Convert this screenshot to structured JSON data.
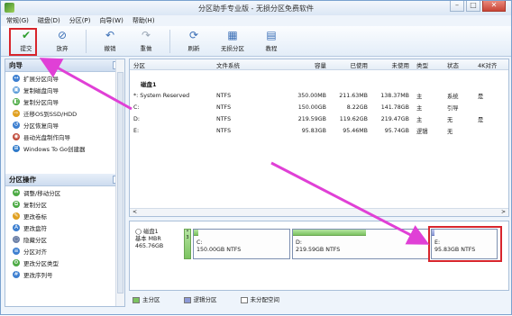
{
  "title": "分区助手专业版 - 无损分区免费软件",
  "menu": [
    "常规(G)",
    "磁盘(D)",
    "分区(P)",
    "向导(W)",
    "帮助(H)"
  ],
  "toolbar": [
    {
      "label": "提交",
      "icon": "check-icon"
    },
    {
      "label": "放弃",
      "icon": "discard-icon"
    },
    {
      "label": "撤销",
      "icon": "undo-icon"
    },
    {
      "label": "重做",
      "icon": "redo-icon"
    },
    {
      "label": "刷新",
      "icon": "refresh-icon"
    },
    {
      "label": "无损分区",
      "icon": "partition-icon"
    },
    {
      "label": "教程",
      "icon": "tutorial-icon"
    }
  ],
  "wizard_panel": {
    "title": "向导",
    "items": [
      "扩展分区向导",
      "复制磁盘向导",
      "复制分区向导",
      "迁移OS到SSD/HDD",
      "分区恢复向导",
      "县动光盘制作向导",
      "Windows To Go创建器"
    ]
  },
  "ops_panel": {
    "title": "分区操作",
    "items": [
      "调整/移动分区",
      "复制分区",
      "更改卷标",
      "更改盘符",
      "隐藏分区",
      "分区对齐",
      "更改分区类型",
      "更改序列号"
    ]
  },
  "table": {
    "headers": [
      "分区",
      "文件系统",
      "容量",
      "已使用",
      "未使用",
      "类型",
      "状态",
      "4K对齐"
    ],
    "disk_label": "磁盘1",
    "rows": [
      [
        "*: System Reserved",
        "NTFS",
        "350.00MB",
        "211.63MB",
        "138.37MB",
        "主",
        "系统",
        "是"
      ],
      [
        "C:",
        "NTFS",
        "150.00GB",
        "8.22GB",
        "141.78GB",
        "主",
        "引导",
        ""
      ],
      [
        "D:",
        "NTFS",
        "219.59GB",
        "119.62GB",
        "219.47GB",
        "主",
        "无",
        "是"
      ],
      [
        "E:",
        "NTFS",
        "95.83GB",
        "95.46MB",
        "95.74GB",
        "逻辑",
        "无",
        ""
      ]
    ]
  },
  "diskmap": {
    "disk_name": "磁盘1",
    "disk_type": "基本 MBR",
    "disk_size": "465.76GB",
    "sys_label": "*",
    "sys_num": "3",
    "parts": [
      {
        "name": "C:",
        "info": "150.00GB NTFS",
        "fill": 0.05
      },
      {
        "name": "D:",
        "info": "219.59GB NTFS",
        "fill": 0.54
      },
      {
        "name": "E:",
        "info": "95.83GB NTFS",
        "fill": 0.01
      }
    ]
  },
  "legend": [
    "主分区",
    "逻辑分区",
    "未分配空间"
  ],
  "colors": {
    "primary": "#7cc360",
    "logical": "#8c99d6",
    "unallocated": "#ffffff",
    "highlight": "#d8252c",
    "arrow": "#e040d6"
  }
}
